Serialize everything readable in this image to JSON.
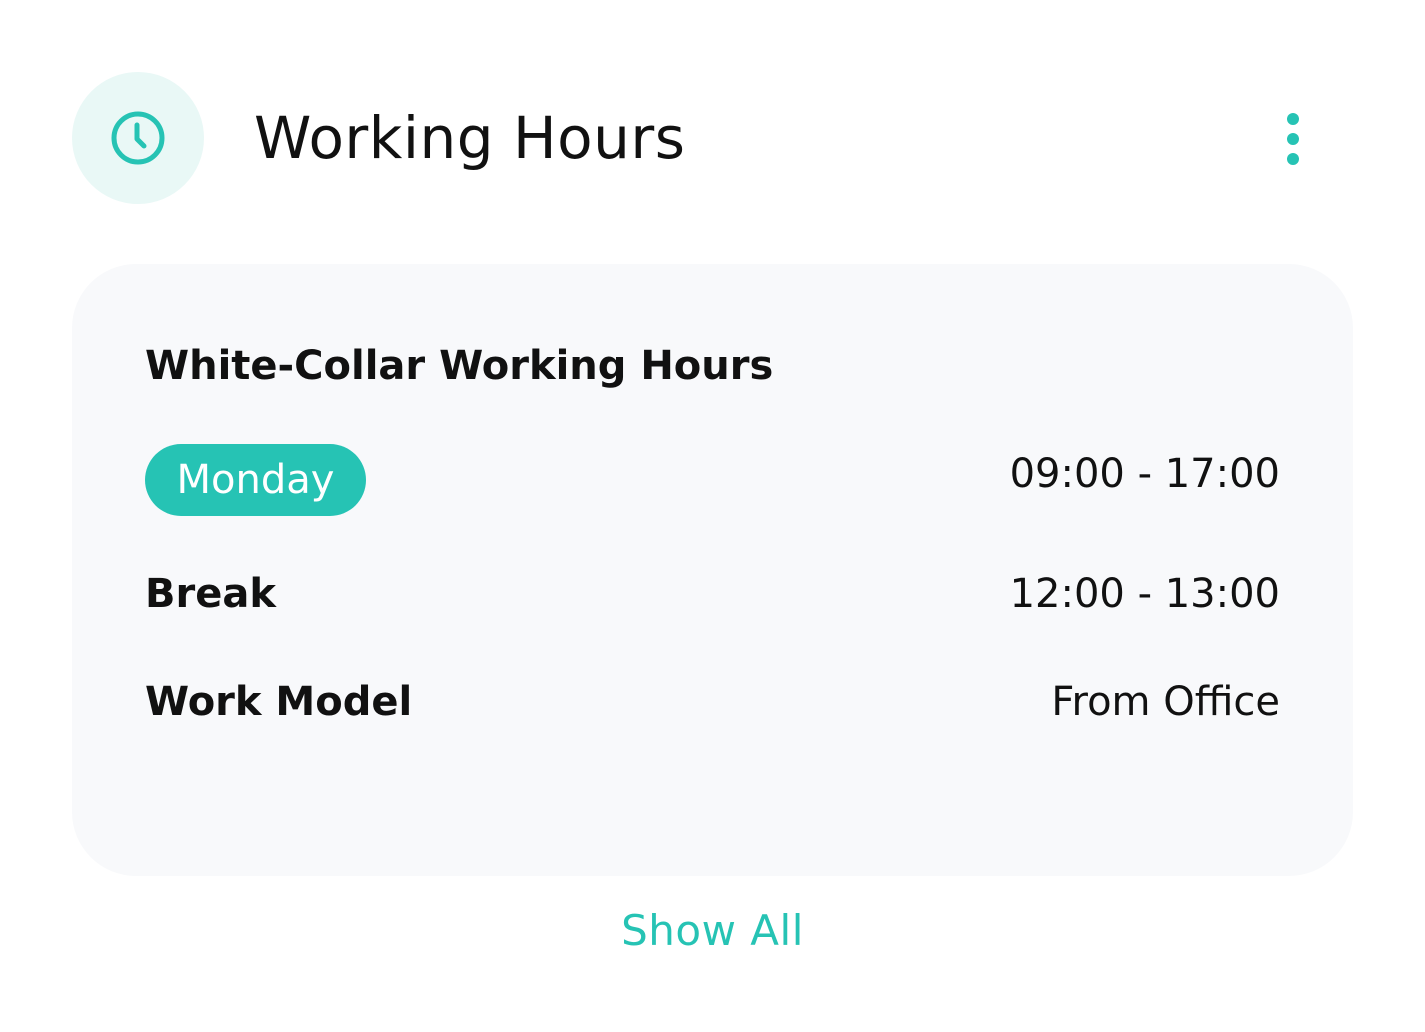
{
  "header": {
    "icon": "clock-icon",
    "title": "Working Hours",
    "menu_icon": "more-vertical-icon"
  },
  "schedule": {
    "title": "White-Collar Working Hours",
    "selected_day": "Monday",
    "working_time": "09:00 - 17:00",
    "break_label": "Break",
    "break_time": "12:00 - 13:00",
    "work_model_label": "Work Model",
    "work_model_value": "From Office"
  },
  "footer": {
    "show_all_label": "Show All"
  },
  "colors": {
    "accent": "#26C3B4",
    "icon_background": "#E9F8F6",
    "panel_background": "#F8F9FB",
    "text": "#111111"
  }
}
